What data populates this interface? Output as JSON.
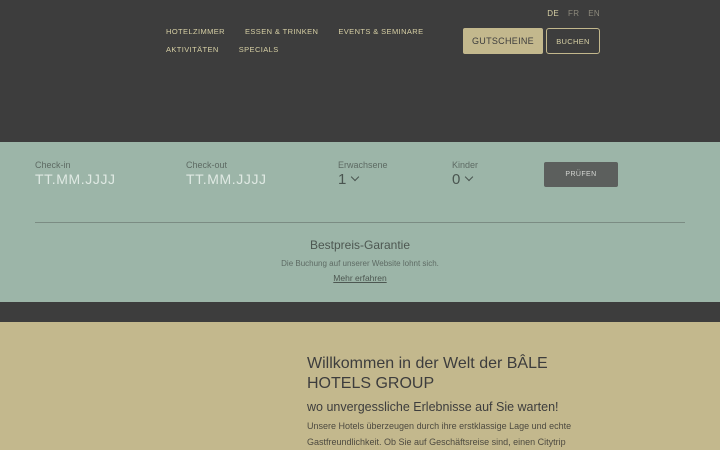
{
  "languages": [
    {
      "code": "DE",
      "active": true
    },
    {
      "code": "FR",
      "active": false
    },
    {
      "code": "EN",
      "active": false
    }
  ],
  "nav": {
    "items": [
      "HOTELZIMMER",
      "ESSEN & TRINKEN",
      "EVENTS & SEMINARE",
      "AKTIVITÄTEN",
      "SPECIALS"
    ]
  },
  "header": {
    "voucher_label": "GUTSCHEINE",
    "book_label": "BUCHEN"
  },
  "booking": {
    "checkin_label": "Check-in",
    "checkin_placeholder": "TT.MM.JJJJ",
    "checkout_label": "Check-out",
    "checkout_placeholder": "TT.MM.JJJJ",
    "adults_label": "Erwachsene",
    "adults_value": "1",
    "children_label": "Kinder",
    "children_value": "0",
    "check_button": "PRÜFEN"
  },
  "guarantee": {
    "title": "Bestpreis-Garantie",
    "text": "Die Buchung auf unserer Website lohnt sich.",
    "link": "Mehr erfahren"
  },
  "welcome": {
    "title": "Willkommen in der Welt der BÂLE HOTELS GROUP",
    "subtitle": "wo unvergessliche Erlebnisse auf Sie warten!",
    "body": "Unsere Hotels überzeugen durch ihre erstklassige Lage und echte Gastfreundlichkeit. Ob Sie auf Geschäftsreise sind, einen Citytrip"
  },
  "colors": {
    "dark": "#3d3d3d",
    "sage": "#9cb5a8",
    "gold": "#c3b88d"
  }
}
